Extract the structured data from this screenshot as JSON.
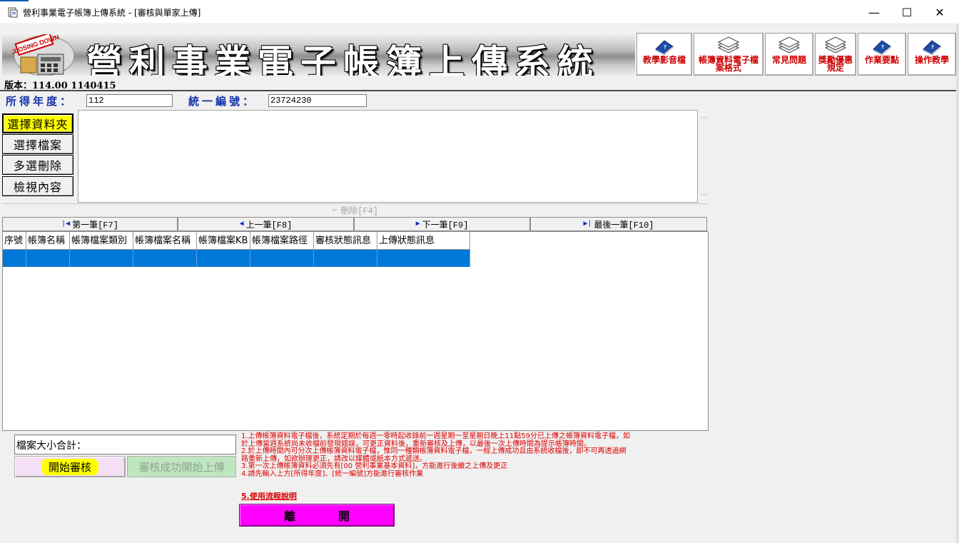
{
  "window": {
    "title": "營利事業電子帳簿上傳系統 - [審核與單家上傳]",
    "minimize": "—",
    "maximize": "☐",
    "close": "✕"
  },
  "banner": {
    "title": "營利事業電子帳簿上傳系統",
    "logo_text": "CLOSING DOWN"
  },
  "toolbar": [
    {
      "label": "教學影音檔",
      "icon": "book-icon"
    },
    {
      "label": "帳簿資料電子檔案格式",
      "icon": "stack-icon"
    },
    {
      "label": "常見問題",
      "icon": "stack-icon"
    },
    {
      "label": "獎勵優惠規定",
      "icon": "stack-icon"
    },
    {
      "label": "作業要點",
      "icon": "book-icon"
    },
    {
      "label": "操作教學",
      "icon": "book-icon"
    }
  ],
  "version": "版本：114.00 1140415",
  "fields": {
    "year_label": "所得年度：",
    "year_value": "112",
    "tax_id_label": "統一編號：",
    "tax_id_value": "23724230"
  },
  "side_buttons": [
    "選擇資料夾",
    "選擇檔案",
    "多選刪除",
    "檢視內容"
  ],
  "delete_label": "刪除[F4]",
  "navigation": {
    "first": "第一筆[F7]",
    "prev": "上一筆[F8]",
    "next": "下一筆[F9]",
    "last": "最後一筆[F10]"
  },
  "grid": {
    "columns": [
      "序號",
      "帳簿名稱",
      "帳簿檔案類別",
      "帳簿檔案名稱",
      "帳簿檔案KB",
      "帳簿檔案路徑",
      "審核狀態訊息",
      "上傳狀態訊息"
    ]
  },
  "bottom": {
    "size_total_label": "檔案大小合計：",
    "start_review": "開始審核",
    "start_upload": "審核成功開始上傳",
    "leave": "離開",
    "flow_link": "5.使用流程說明"
  },
  "notes": [
    "1.上傳帳簿資料電子檔後，系統定期於每週一零時起收錄前一週星期一至星期日晚上11點59分已上傳之帳簿資料電子檔，如於上傳當週系統尚未收檔前發現錯誤，可更正資料後，重新審核及上傳，以最後一次上傳時間為提示帳簿時間。",
    "2.於上傳時間內可分次上傳帳簿資料電子檔，惟同一種類帳簿資料電子檔，一經上傳成功且由系統收檔後，即不可再透過網路重新上傳，如欲辦理更正，請改以媒體或紙本方式遞送。",
    "3.第一次上傳帳簿資料必須先有[00 營利事業基本資料]，方能進行後續之上傳及更正",
    "4.請先輸入上方[所得年度]、[統一編號]方能進行審核作業"
  ],
  "colors": {
    "accent_blue": "#0078d7",
    "label_blue": "#1133aa",
    "note_red": "#dd0000",
    "leave_magenta": "#ff00ff",
    "highlight_yellow": "#ffff00"
  }
}
